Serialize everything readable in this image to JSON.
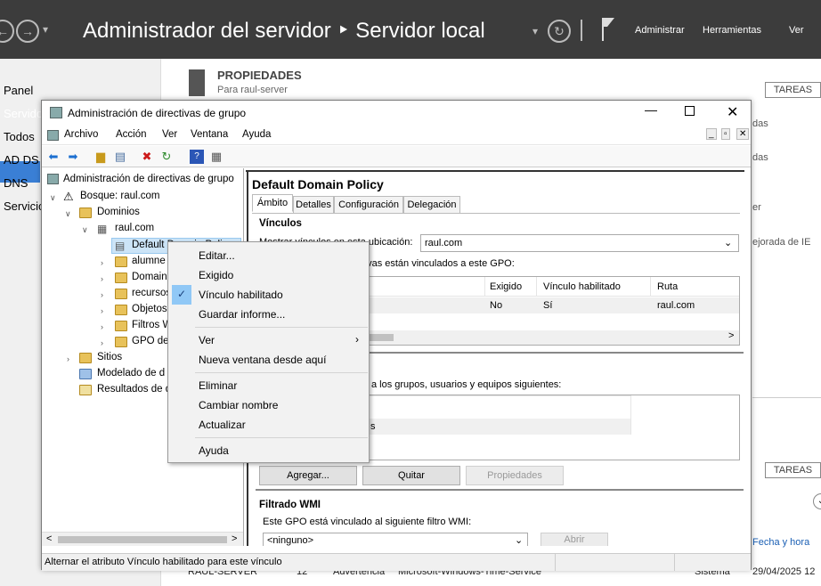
{
  "server_manager": {
    "title": "Administrador del servidor",
    "breadcrumb_arrow": "‣",
    "breadcrumb_current": "Servidor local",
    "menus": [
      "Administrar",
      "Herramientas",
      "Ver"
    ],
    "nav": [
      "Panel",
      "Servidor",
      "Todos",
      "AD DS",
      "DNS",
      "Servicios"
    ],
    "properties_title": "PROPIEDADES",
    "properties_sub": "Para raul-server",
    "tareas": "TAREAS",
    "bg_texts": [
      "das",
      "das",
      "er",
      "ejorada de IE"
    ],
    "fecha_col": "Fecha y hora",
    "row": {
      "server": "RAUL-SERVER",
      "id": "12",
      "level": "Advertencia",
      "source": "Microsoft-Windows-Time-Service",
      "log": "Sistema",
      "date": "29/04/2025 12"
    }
  },
  "gpmc": {
    "window_title": "Administración de directivas de grupo",
    "menu": [
      "Archivo",
      "Acción",
      "Ver",
      "Ventana",
      "Ayuda"
    ],
    "tree": {
      "root": "Administración de directivas de grupo",
      "forest": "Bosque: raul.com",
      "domains": "Dominios",
      "domain": "raul.com",
      "items": [
        "Default Domain Poli",
        "alumne",
        "Domain",
        "recursos",
        "Objetos",
        "Filtros W",
        "GPO de"
      ],
      "sites": "Sitios",
      "modeling": "Modelado de d",
      "results": "Resultados de d"
    },
    "policy_title": "Default Domain Policy",
    "tabs": [
      "Ámbito",
      "Detalles",
      "Configuración",
      "Delegación"
    ],
    "links_heading": "Vínculos",
    "show_links_label": "Mostrar vínculos en esta ubicación:",
    "location_value": "raul.com",
    "links_desc": "ios y unidades organizativas están vinculados a este GPO:",
    "table_headers": [
      "Exigido",
      "Vínculo habilitado",
      "Ruta"
    ],
    "table_row": [
      "No",
      "Sí",
      "raul.com"
    ],
    "security_desc": "PO solo se puede aplicar a los grupos, usuarios y equipos siguientes:",
    "security_item": "s",
    "buttons": [
      "Agregar...",
      "Quitar",
      "Propiedades"
    ],
    "wmi_heading": "Filtrado WMI",
    "wmi_desc": "Este GPO está vinculado al siguiente filtro WMI:",
    "wmi_value": "<ninguno>",
    "wmi_button": "Abrir",
    "status": "Alternar el atributo Vínculo habilitado para este vínculo"
  },
  "context_menu": [
    "Editar...",
    "Exigido",
    "Vínculo habilitado",
    "Guardar informe...",
    "Ver",
    "Nueva ventana desde aquí",
    "Eliminar",
    "Cambiar nombre",
    "Actualizar",
    "Ayuda"
  ]
}
